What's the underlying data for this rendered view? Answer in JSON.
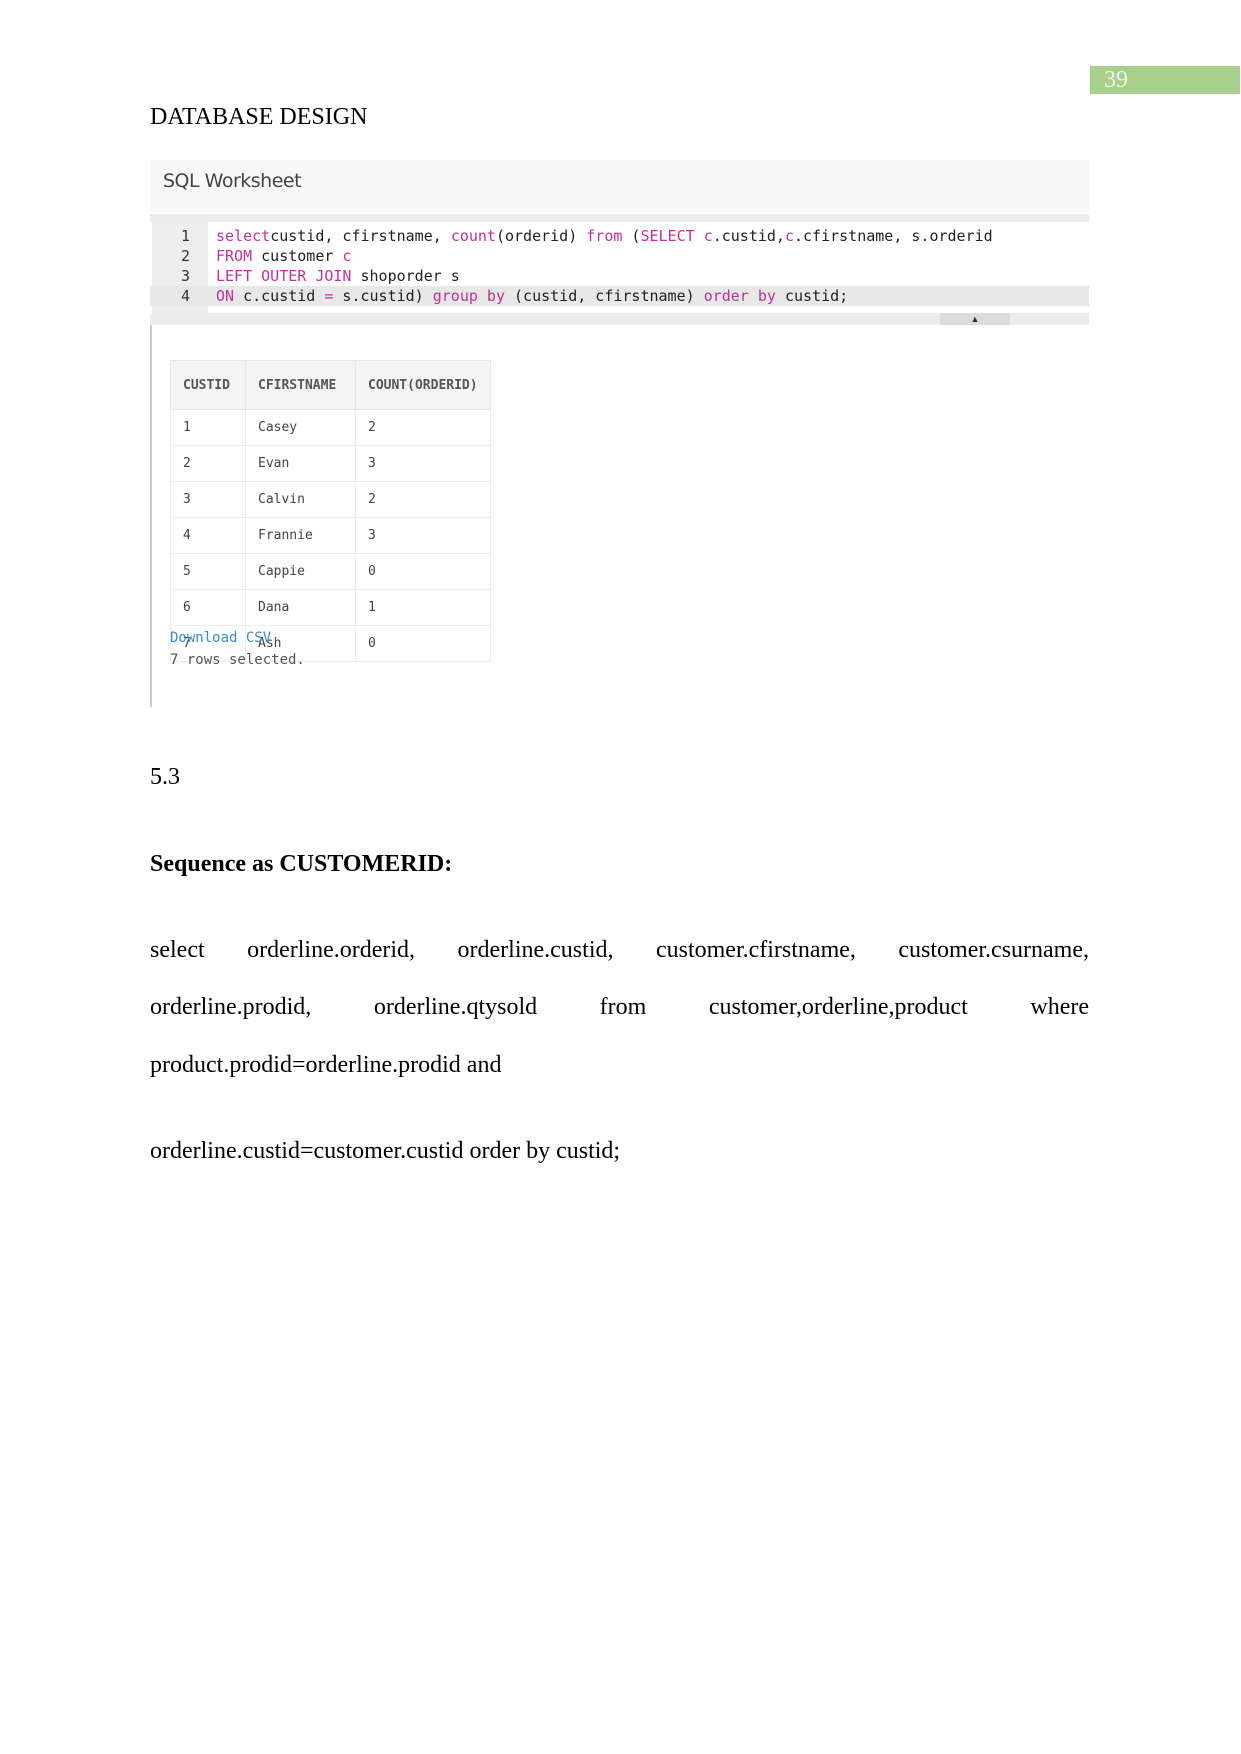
{
  "page_number": "39",
  "heading": "DATABASE DESIGN",
  "worksheet": {
    "title": "SQL Worksheet",
    "code_lines": [
      {
        "num": "1",
        "parts": [
          [
            "kw",
            "select"
          ],
          [
            "",
            "custid, cfirstname, "
          ],
          [
            "kw",
            "count"
          ],
          [
            "",
            "(orderid) "
          ],
          [
            "kw",
            "from"
          ],
          [
            "",
            " ("
          ],
          [
            "kw",
            "SELECT"
          ],
          [
            "",
            " "
          ],
          [
            "kw",
            "c"
          ],
          [
            "",
            ".custid,"
          ],
          [
            "kw",
            "c"
          ],
          [
            "",
            ".cfirstname, s.orderid"
          ]
        ]
      },
      {
        "num": "2",
        "parts": [
          [
            "kw",
            "FROM"
          ],
          [
            "",
            " customer "
          ],
          [
            "kw",
            "c"
          ]
        ]
      },
      {
        "num": "3",
        "parts": [
          [
            "kw",
            "LEFT OUTER JOIN"
          ],
          [
            "",
            " shoporder s"
          ]
        ]
      },
      {
        "num": "4",
        "parts": [
          [
            "kw",
            "ON"
          ],
          [
            "",
            " c.custid "
          ],
          [
            "kw",
            "="
          ],
          [
            "",
            " s.custid) "
          ],
          [
            "kw",
            "group by"
          ],
          [
            "",
            " (custid, cfirstname) "
          ],
          [
            "kw",
            "order by"
          ],
          [
            "",
            " custid;"
          ]
        ]
      }
    ],
    "keyword_color": "#c2319a",
    "table": {
      "columns": [
        "CUSTID",
        "CFIRSTNAME",
        "COUNT(ORDERID)"
      ],
      "rows": [
        [
          "1",
          "Casey",
          "2"
        ],
        [
          "2",
          "Evan",
          "3"
        ],
        [
          "3",
          "Calvin",
          "2"
        ],
        [
          "4",
          "Frannie",
          "3"
        ],
        [
          "5",
          "Cappie",
          "0"
        ],
        [
          "6",
          "Dana",
          "1"
        ],
        [
          "7",
          "Ash",
          "0"
        ]
      ]
    },
    "download_label": "Download CSV",
    "rows_selected": "7 rows selected."
  },
  "section_number": "5.3",
  "section_title": "Sequence as CUSTOMERID:",
  "query_lines": [
    "select orderline.orderid, orderline.custid, customer.cfirstname, customer.csurname,",
    "orderline.prodid, orderline.qtysold from customer,orderline,product where",
    "product.prodid=orderline.prodid and"
  ],
  "query_last_line": "orderline.custid=customer.custid order by custid;"
}
